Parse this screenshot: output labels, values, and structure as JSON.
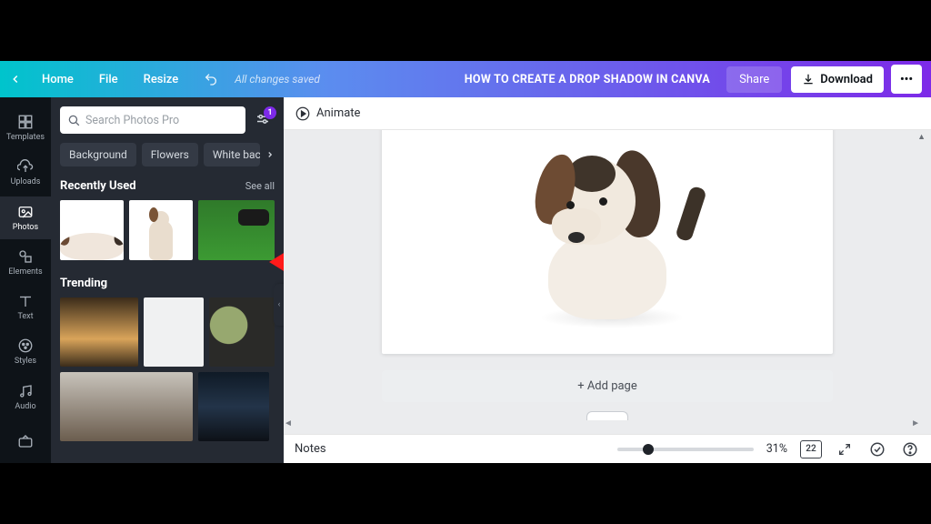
{
  "topbar": {
    "home": "Home",
    "file": "File",
    "resize": "Resize",
    "saved": "All changes saved",
    "title": "HOW TO CREATE A DROP SHADOW IN CANVA",
    "share": "Share",
    "download": "Download",
    "more": "•••"
  },
  "rail": {
    "templates": "Templates",
    "uploads": "Uploads",
    "photos": "Photos",
    "elements": "Elements",
    "text": "Text",
    "styles": "Styles",
    "audio": "Audio"
  },
  "panel": {
    "search_placeholder": "Search Photos Pro",
    "filter_count": "1",
    "chips": [
      "Background",
      "Flowers",
      "White background"
    ],
    "recent_heading": "Recently Used",
    "see_all": "See all",
    "trending_heading": "Trending"
  },
  "canvas": {
    "animate": "Animate",
    "add_page": "+ Add page"
  },
  "footer": {
    "notes": "Notes",
    "zoom_pct": "31%",
    "page_badge": "22"
  }
}
